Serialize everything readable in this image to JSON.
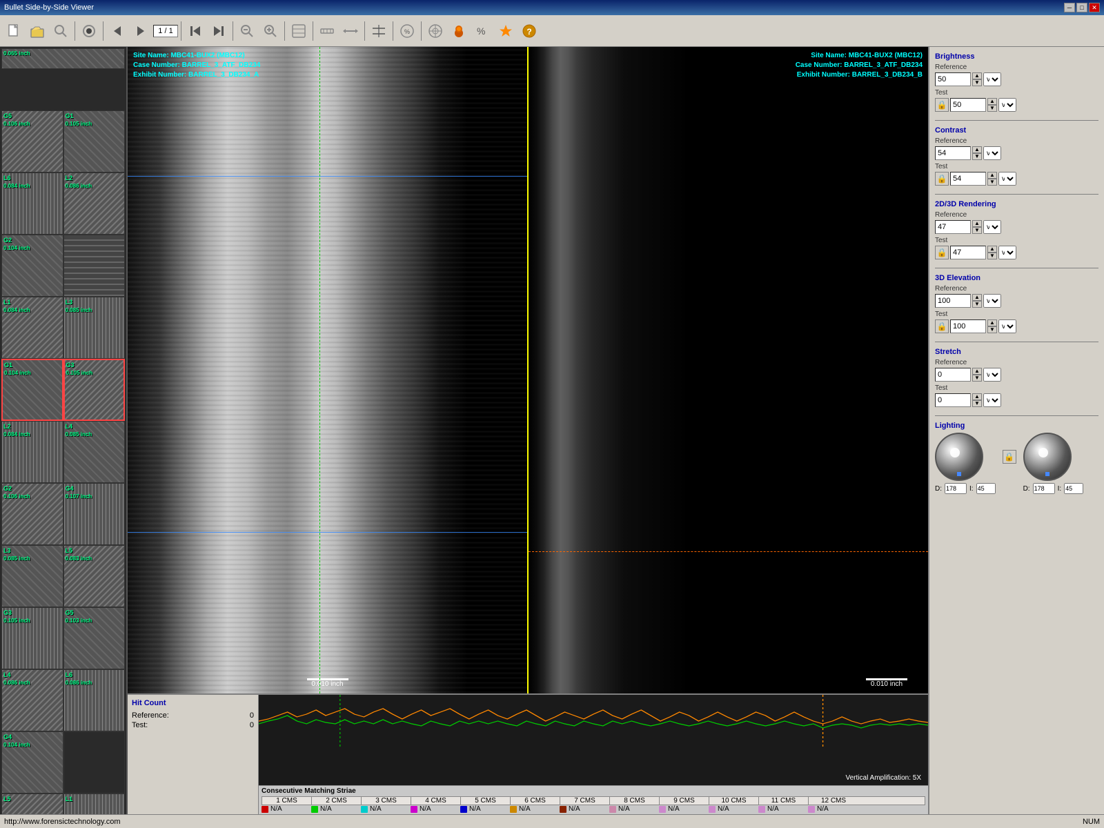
{
  "app": {
    "title": "Bullet Side-by-Side Viewer"
  },
  "titlebar": {
    "title": "Bullet Side-by-Side Viewer",
    "minimize_label": "─",
    "maximize_label": "□",
    "close_label": "✕"
  },
  "toolbar": {
    "nav_display": "1 / 1"
  },
  "viewer": {
    "left_info": {
      "site": "Site Name: MBC41-BUX2 (MBC12)",
      "case": "Case Number: BARREL_3_ATF_DB234",
      "exhibit": "Exhibit Number: BARREL_3_DB234_A"
    },
    "right_info": {
      "site": "Site Name: MBC41-BUX2 (MBC12)",
      "case": "Case Number: BARREL_3_ATF_DB234",
      "exhibit": "Exhibit Number: BARREL_3_DB234_B"
    },
    "scale_left": "0.010 inch",
    "scale_right": "0.010 inch"
  },
  "thumbnails": [
    {
      "label": "G5",
      "sub": "0.106 inch",
      "col": 0,
      "bg": "thumb-bg-2"
    },
    {
      "label": "G1",
      "sub": "0.105 inch",
      "col": 1,
      "bg": "thumb-bg-1"
    },
    {
      "label": "L6",
      "sub": "0.084 inch",
      "col": 0,
      "bg": "thumb-bg-3"
    },
    {
      "label": "L2",
      "sub": "0.086 inch",
      "col": 1,
      "bg": "thumb-bg-2"
    },
    {
      "label": "G2",
      "sub": "0.104 inch",
      "col": 0,
      "bg": "thumb-bg-1"
    },
    {
      "label": "",
      "sub": "",
      "col": 1,
      "bg": "thumb-bg-4"
    },
    {
      "label": "L1",
      "sub": "0.084 inch",
      "col": 0,
      "bg": "thumb-bg-2"
    },
    {
      "label": "L3",
      "sub": "0.085 inch",
      "col": 1,
      "bg": "thumb-bg-3"
    },
    {
      "label": "G1",
      "sub": "0.104 inch",
      "col": 0,
      "bg": "thumb-bg-1"
    },
    {
      "label": "G3",
      "sub": "0.105 inch",
      "col": 1,
      "bg": "thumb-bg-2"
    },
    {
      "label": "L2",
      "sub": "0.084 inch",
      "col": 0,
      "bg": "thumb-bg-3"
    },
    {
      "label": "L4",
      "sub": "0.085 inch",
      "col": 1,
      "bg": "thumb-bg-1"
    },
    {
      "label": "G2",
      "sub": "0.106 inch",
      "col": 0,
      "bg": "thumb-bg-2"
    },
    {
      "label": "G4",
      "sub": "0.107 inch",
      "col": 1,
      "bg": "thumb-bg-3"
    },
    {
      "label": "L3",
      "sub": "0.085 inch",
      "col": 0,
      "bg": "thumb-bg-1"
    },
    {
      "label": "L5",
      "sub": "0.083 inch",
      "col": 1,
      "bg": "thumb-bg-2"
    },
    {
      "label": "G3",
      "sub": "0.105 inch",
      "col": 0,
      "bg": "thumb-bg-3"
    },
    {
      "label": "G5",
      "sub": "0.103 inch",
      "col": 1,
      "bg": "thumb-bg-1"
    },
    {
      "label": "L4",
      "sub": "0.086 inch",
      "col": 0,
      "bg": "thumb-bg-2"
    },
    {
      "label": "L6",
      "sub": "0.086 inch",
      "col": 1,
      "bg": "thumb-bg-3"
    },
    {
      "label": "G4",
      "sub": "0.104 inch",
      "col": 0,
      "bg": "thumb-bg-1"
    },
    {
      "label": "",
      "sub": "",
      "col": 1,
      "bg": "thumb-bg-4"
    },
    {
      "label": "L5",
      "sub": "",
      "col": 0,
      "bg": "thumb-bg-2"
    },
    {
      "label": "L1",
      "sub": "",
      "col": 1,
      "bg": "thumb-bg-3"
    }
  ],
  "hit_count": {
    "title": "Hit Count",
    "reference_label": "Reference:",
    "reference_value": "0",
    "test_label": "Test:",
    "test_value": "0"
  },
  "chart": {
    "vertical_amp": "Vertical Amplification: 5X"
  },
  "cms": {
    "title": "Consecutive Matching Striae",
    "headers": [
      "1 CMS",
      "2 CMS",
      "3 CMS",
      "4 CMS",
      "5 CMS",
      "6 CMS",
      "7 CMS",
      "8 CMS",
      "9 CMS",
      "10 CMS",
      "11 CMS",
      "12 CMS"
    ],
    "legend_colors": [
      "#cc0000",
      "#00cc00",
      "#00cccc",
      "#cc00cc",
      "#0000cc",
      "#cc8800",
      "#882200",
      "#cc88cc",
      "#cc88cc",
      "#cc88cc",
      "#cc88cc",
      "#cc88cc"
    ],
    "legend_labels": [
      "N/A",
      "N/A",
      "N/A",
      "N/A",
      "N/A",
      "N/A",
      "N/A",
      "N/A",
      "N/A",
      "N/A",
      "N/A",
      "N/A"
    ]
  },
  "brightness": {
    "title": "Brightness",
    "reference_label": "Reference",
    "reference_value": "50",
    "test_label": "Test",
    "test_value": "50"
  },
  "contrast": {
    "title": "Contrast",
    "reference_label": "Reference",
    "reference_value": "54",
    "test_label": "Test",
    "test_value": "54"
  },
  "rendering": {
    "title": "2D/3D Rendering",
    "reference_label": "Reference",
    "reference_value": "47",
    "test_label": "Test",
    "test_value": "47"
  },
  "elevation": {
    "title": "3D Elevation",
    "reference_label": "Reference",
    "reference_value": "100",
    "test_label": "Test",
    "test_value": "100"
  },
  "stretch": {
    "title": "Stretch",
    "reference_label": "Reference",
    "reference_value": "0",
    "test_label": "Test",
    "test_value": "0"
  },
  "lighting": {
    "title": "Lighting",
    "d_label_1": "D:",
    "d_value_1": "178",
    "i_label_1": "I:",
    "i_value_1": "45",
    "d_label_2": "D:",
    "d_value_2": "178",
    "i_label_2": "I:",
    "i_value_2": "45"
  },
  "statusbar": {
    "url": "http://www.forensictechnology.com",
    "mode": "NUM"
  }
}
